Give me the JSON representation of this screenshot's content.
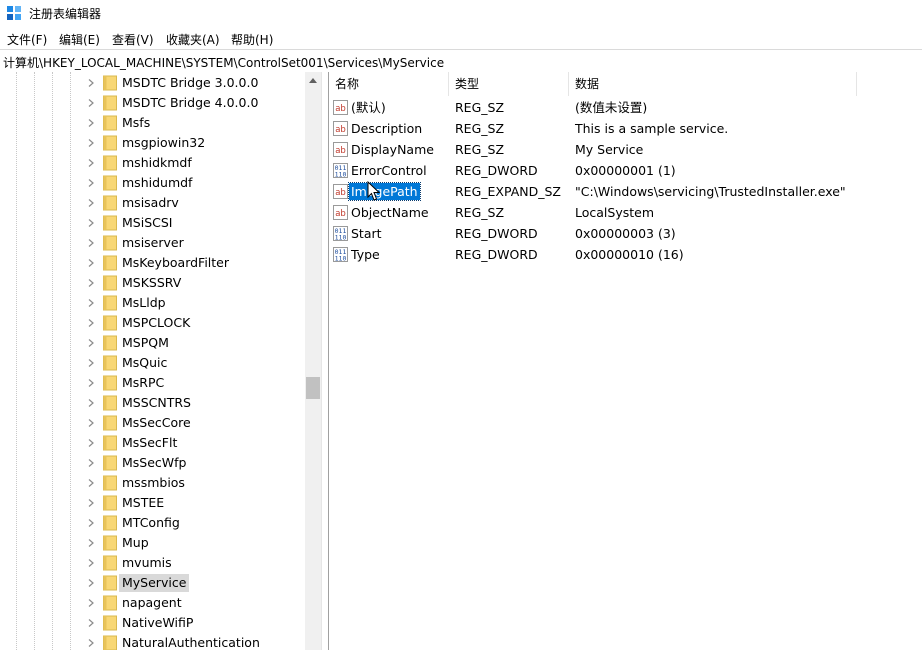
{
  "window": {
    "title": "注册表编辑器",
    "icon": "regedit-icon"
  },
  "menu": [
    "文件(F)",
    "编辑(E)",
    "查看(V)",
    "收藏夹(A)",
    "帮助(H)"
  ],
  "address": "计算机\\HKEY_LOCAL_MACHINE\\SYSTEM\\ControlSet001\\Services\\MyService",
  "tree": {
    "items": [
      "MSDTC Bridge 3.0.0.0",
      "MSDTC Bridge 4.0.0.0",
      "Msfs",
      "msgpiowin32",
      "mshidkmdf",
      "mshidumdf",
      "msisadrv",
      "MSiSCSI",
      "msiserver",
      "MsKeyboardFilter",
      "MSKSSRV",
      "MsLldp",
      "MSPCLOCK",
      "MSPQM",
      "MsQuic",
      "MsRPC",
      "MSSCNTRS",
      "MsSecCore",
      "MsSecFlt",
      "MsSecWfp",
      "mssmbios",
      "MSTEE",
      "MTConfig",
      "Mup",
      "mvumis",
      "MyService",
      "napagent",
      "NativeWifiP",
      "NaturalAuthentication"
    ],
    "selected": "MyService"
  },
  "list": {
    "headers": {
      "name": "名称",
      "type": "类型",
      "data": "数据"
    },
    "rows": [
      {
        "icon": "string-value-icon",
        "name": "(默认)",
        "type": "REG_SZ",
        "data": "(数值未设置)"
      },
      {
        "icon": "string-value-icon",
        "name": "Description",
        "type": "REG_SZ",
        "data": "This is a sample service."
      },
      {
        "icon": "string-value-icon",
        "name": "DisplayName",
        "type": "REG_SZ",
        "data": "My Service"
      },
      {
        "icon": "binary-value-icon",
        "name": "ErrorControl",
        "type": "REG_DWORD",
        "data": "0x00000001 (1)"
      },
      {
        "icon": "string-value-icon",
        "name": "ImagePath",
        "type": "REG_EXPAND_SZ",
        "data": "\"C:\\Windows\\servicing\\TrustedInstaller.exe\""
      },
      {
        "icon": "string-value-icon",
        "name": "ObjectName",
        "type": "REG_SZ",
        "data": "LocalSystem"
      },
      {
        "icon": "binary-value-icon",
        "name": "Start",
        "type": "REG_DWORD",
        "data": "0x00000003 (3)"
      },
      {
        "icon": "binary-value-icon",
        "name": "Type",
        "type": "REG_DWORD",
        "data": "0x00000010 (16)"
      }
    ],
    "selected": "ImagePath"
  },
  "colors": {
    "selection": "#0078d7",
    "tree_selection": "#d9d9d9",
    "folder": "#f8d775"
  }
}
